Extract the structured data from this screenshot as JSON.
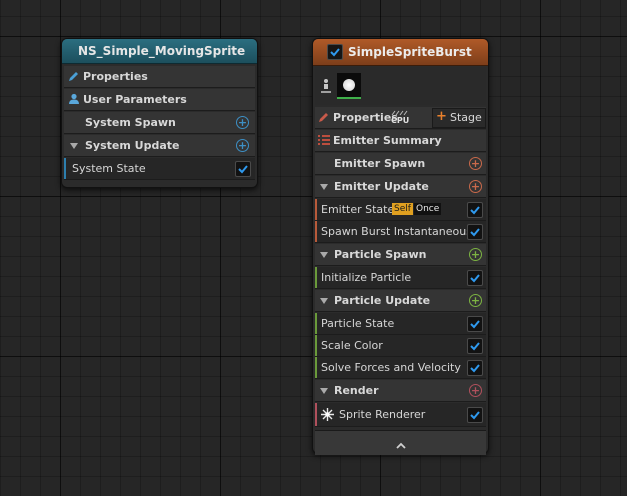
{
  "system_node": {
    "title": "NS_Simple_MovingSprite",
    "properties": "Properties",
    "user_parameters": "User Parameters",
    "system_spawn": "System Spawn",
    "system_update": "System Update",
    "system_state": "System State"
  },
  "emitter_node": {
    "title": "SimpleSpriteBurst",
    "properties": "Properties",
    "cpu_badge": "CPU",
    "stage_button": "Stage",
    "emitter_summary": "Emitter Summary",
    "emitter_spawn": "Emitter Spawn",
    "emitter_update": "Emitter Update",
    "emitter_state": "Emitter State",
    "self_tag": "Self",
    "once_tag": "Once",
    "spawn_burst": "Spawn Burst Instantaneous",
    "particle_spawn": "Particle Spawn",
    "initialize_particle": "Initialize Particle",
    "particle_update": "Particle Update",
    "particle_state": "Particle State",
    "scale_color": "Scale Color",
    "solve_forces": "Solve Forces and Velocity",
    "render": "Render",
    "sprite_renderer": "Sprite Renderer"
  },
  "colors": {
    "system_header": "#1f5a69",
    "emitter_header": "#9a4e22",
    "accent_blue": "#3d8fc4",
    "spawn_orange": "#c9694a",
    "particle_green": "#7cb342",
    "render_red": "#b0505c",
    "check_blue": "#2f9aef"
  }
}
